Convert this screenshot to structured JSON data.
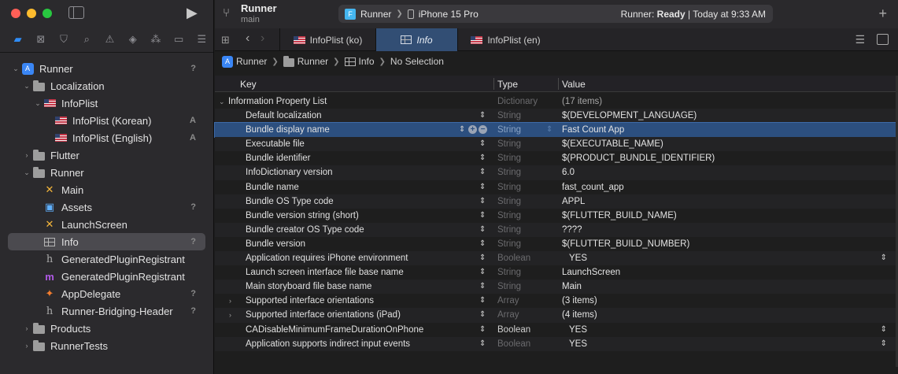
{
  "sidebar": {
    "traffic_lights": [
      "#ff5f57",
      "#febc2e",
      "#28c840"
    ],
    "nav_icons": [
      "folder-icon",
      "x-square-icon",
      "bookmark-icon",
      "search-icon",
      "warning-icon",
      "diamond-icon",
      "spray-icon",
      "label-icon",
      "list-icon"
    ],
    "tree": [
      {
        "label": "Runner",
        "badge": "?",
        "indent": 0,
        "chevron": "⌄",
        "icon": "app"
      },
      {
        "label": "Localization",
        "badge": "",
        "indent": 1,
        "chevron": "⌄",
        "icon": "folder"
      },
      {
        "label": "InfoPlist",
        "badge": "",
        "indent": 2,
        "chevron": "⌄",
        "icon": "flag"
      },
      {
        "label": "InfoPlist (Korean)",
        "badge": "A",
        "indent": 3,
        "chevron": "",
        "icon": "flag"
      },
      {
        "label": "InfoPlist (English)",
        "badge": "A",
        "indent": 3,
        "chevron": "",
        "icon": "flag"
      },
      {
        "label": "Flutter",
        "badge": "",
        "indent": 1,
        "chevron": "›",
        "icon": "folder"
      },
      {
        "label": "Runner",
        "badge": "",
        "indent": 1,
        "chevron": "⌄",
        "icon": "folder"
      },
      {
        "label": "Main",
        "badge": "",
        "indent": 2,
        "chevron": "",
        "icon": "storyboard"
      },
      {
        "label": "Assets",
        "badge": "?",
        "indent": 2,
        "chevron": "",
        "icon": "assets"
      },
      {
        "label": "LaunchScreen",
        "badge": "",
        "indent": 2,
        "chevron": "",
        "icon": "storyboard"
      },
      {
        "label": "Info",
        "badge": "?",
        "indent": 2,
        "chevron": "",
        "icon": "grid",
        "selected": true
      },
      {
        "label": "GeneratedPluginRegistrant",
        "badge": "",
        "indent": 2,
        "chevron": "",
        "icon": "h"
      },
      {
        "label": "GeneratedPluginRegistrant",
        "badge": "",
        "indent": 2,
        "chevron": "",
        "icon": "m"
      },
      {
        "label": "AppDelegate",
        "badge": "?",
        "indent": 2,
        "chevron": "",
        "icon": "swift"
      },
      {
        "label": "Runner-Bridging-Header",
        "badge": "?",
        "indent": 2,
        "chevron": "",
        "icon": "h"
      },
      {
        "label": "Products",
        "badge": "",
        "indent": 1,
        "chevron": "›",
        "icon": "folder"
      },
      {
        "label": "RunnerTests",
        "badge": "",
        "indent": 1,
        "chevron": "›",
        "icon": "folder"
      }
    ]
  },
  "titlebar": {
    "project": "Runner",
    "branch": "main",
    "scheme": "Runner",
    "device": "iPhone 15 Pro",
    "status_prefix": "Runner: ",
    "status_state": "Ready",
    "status_suffix": " | Today at 9:33 AM"
  },
  "tabs": [
    {
      "label": "InfoPlist (ko)",
      "icon": "flag"
    },
    {
      "label": "Info",
      "icon": "grid",
      "active": true
    },
    {
      "label": "InfoPlist (en)",
      "icon": "flag"
    }
  ],
  "breadcrumb": [
    "Runner",
    "Runner",
    "Info",
    "No Selection"
  ],
  "table": {
    "headers": {
      "key": "Key",
      "type": "Type",
      "value": "Value"
    },
    "rows": [
      {
        "key": "Information Property List",
        "type": "Dictionary",
        "value": "(17 items)",
        "root": true,
        "expand": "⌄"
      },
      {
        "key": "Default localization",
        "type": "String",
        "value": "$(DEVELOPMENT_LANGUAGE)"
      },
      {
        "key": "Bundle display name",
        "type": "String",
        "value": "Fast Count App",
        "selected": true
      },
      {
        "key": "Executable file",
        "type": "String",
        "value": "$(EXECUTABLE_NAME)"
      },
      {
        "key": "Bundle identifier",
        "type": "String",
        "value": "$(PRODUCT_BUNDLE_IDENTIFIER)"
      },
      {
        "key": "InfoDictionary version",
        "type": "String",
        "value": "6.0"
      },
      {
        "key": "Bundle name",
        "type": "String",
        "value": "fast_count_app"
      },
      {
        "key": "Bundle OS Type code",
        "type": "String",
        "value": "APPL"
      },
      {
        "key": "Bundle version string (short)",
        "type": "String",
        "value": "$(FLUTTER_BUILD_NAME)"
      },
      {
        "key": "Bundle creator OS Type code",
        "type": "String",
        "value": "????"
      },
      {
        "key": "Bundle version",
        "type": "String",
        "value": "$(FLUTTER_BUILD_NUMBER)"
      },
      {
        "key": "Application requires iPhone environment",
        "type": "Boolean",
        "value": "YES",
        "bool": true
      },
      {
        "key": "Launch screen interface file base name",
        "type": "String",
        "value": "LaunchScreen"
      },
      {
        "key": "Main storyboard file base name",
        "type": "String",
        "value": "Main"
      },
      {
        "key": "Supported interface orientations",
        "type": "Array",
        "value": "(3 items)",
        "expand": "›"
      },
      {
        "key": "Supported interface orientations (iPad)",
        "type": "Array",
        "value": "(4 items)",
        "expand": "›"
      },
      {
        "key": "CADisableMinimumFrameDurationOnPhone",
        "type": "Boolean",
        "value": "YES",
        "bool": true,
        "typeBright": true
      },
      {
        "key": "Application supports indirect input events",
        "type": "Boolean",
        "value": "YES",
        "bool": true
      }
    ]
  }
}
